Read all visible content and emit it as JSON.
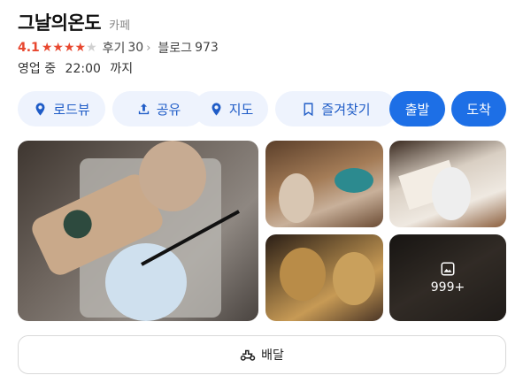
{
  "place": {
    "name": "그날의온도",
    "category": "카페",
    "rating": "4.1",
    "stars_filled": 4,
    "stars_total": 5,
    "review_label": "후기",
    "review_count": "30",
    "blog_label": "블로그",
    "blog_count": "973"
  },
  "hours": {
    "status": "영업 중",
    "close_time": "22:00",
    "suffix": "까지"
  },
  "actions": {
    "road_view": "로드뷰",
    "share": "공유",
    "map": "지도",
    "bookmark": "즐겨찾기",
    "depart": "출발",
    "arrive": "도착"
  },
  "photos": {
    "more_count": "999+"
  },
  "delivery": {
    "label": "배달"
  },
  "colors": {
    "accent": "#1d6fe6",
    "rating": "#e8472f",
    "pill_bg": "#eef3fd"
  }
}
